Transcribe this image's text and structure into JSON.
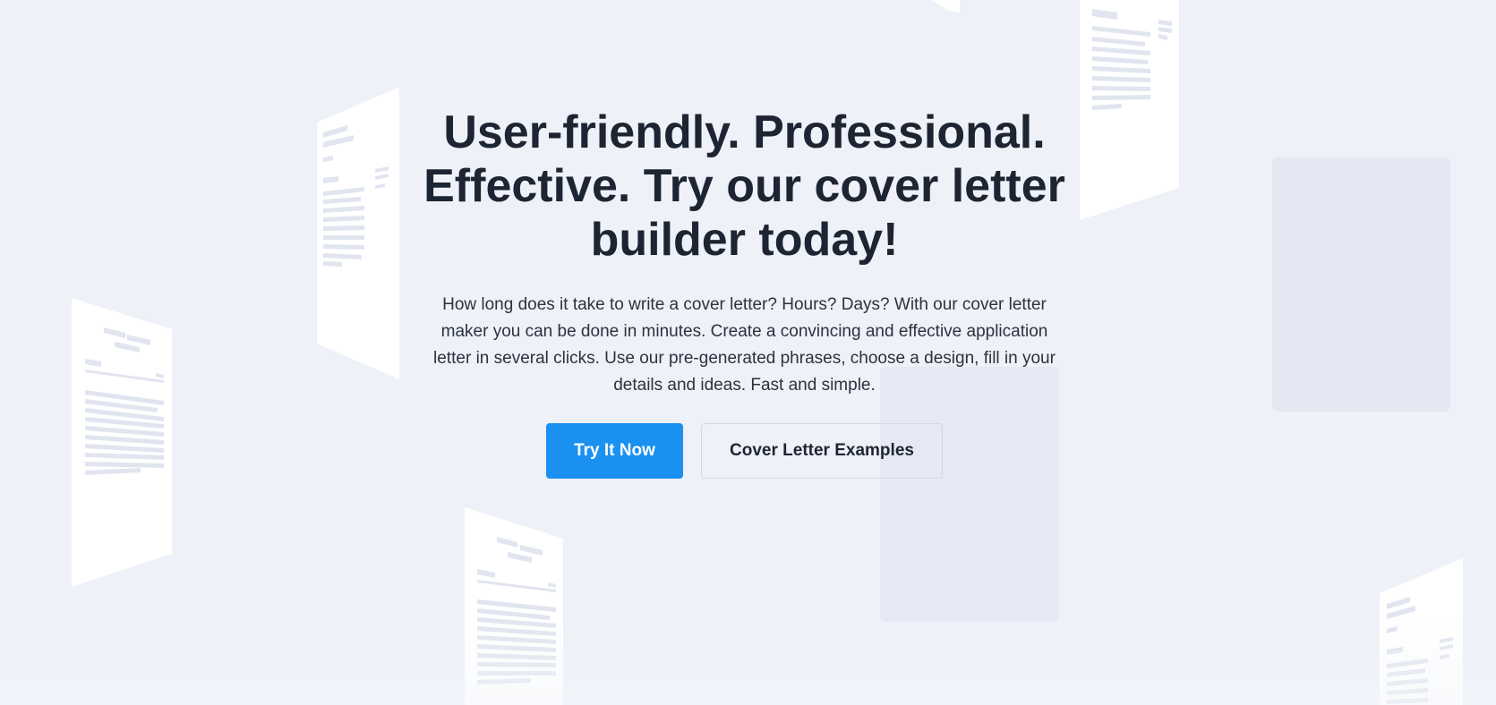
{
  "hero": {
    "title": "User-friendly. Professional. Effective. Try our cover letter builder today!",
    "description": "How long does it take to write a cover letter? Hours? Days? With our cover letter maker you can be done in minutes. Create a convincing and effective application letter in several clicks. Use our pre-generated phrases, choose a design, fill in your details and ideas. Fast and simple."
  },
  "actions": {
    "primary_label": "Try It Now",
    "secondary_label": "Cover Letter Examples"
  },
  "colors": {
    "background": "#eef1f8",
    "title": "#1e2532",
    "body_text": "#2b3240",
    "primary_button": "#1a91f0",
    "primary_button_text": "#ffffff",
    "secondary_button_border": "#d3d8e2",
    "document_paper": "#ffffff",
    "document_lines": "#dde2ee",
    "placeholder_card": "#e4e7f1"
  },
  "decorations": [
    "floating-document-illustration",
    "blank-card-placeholder"
  ]
}
